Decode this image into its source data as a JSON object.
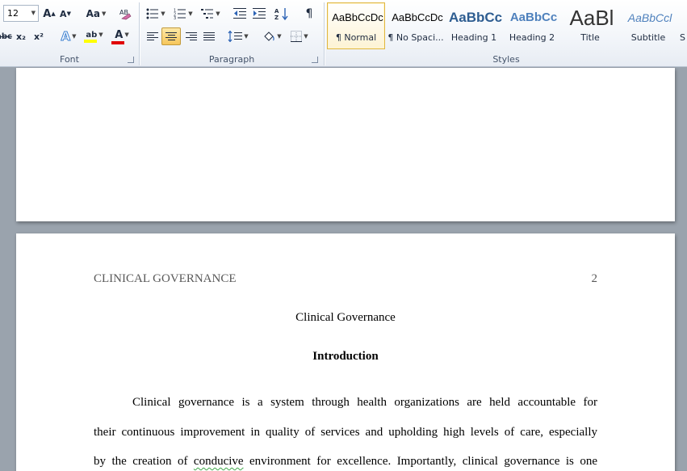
{
  "font_group": {
    "label": "Font",
    "font_size": "12",
    "grow_font": "A",
    "shrink_font": "A",
    "change_case": "Aa",
    "strikethrough": "abc",
    "subscript": "x₂",
    "superscript": "x²",
    "text_effects": "A",
    "highlight": "ab",
    "font_color": "A"
  },
  "paragraph_group": {
    "label": "Paragraph",
    "show_marks": "¶",
    "sort": "A↓Z"
  },
  "styles_group": {
    "label": "Styles",
    "tiles": [
      {
        "sample": "AaBbCcDc",
        "name": "¶ Normal"
      },
      {
        "sample": "AaBbCcDc",
        "name": "¶ No Spaci..."
      },
      {
        "sample": "AaBbCc",
        "name": "Heading 1"
      },
      {
        "sample": "AaBbCc",
        "name": "Heading 2"
      },
      {
        "sample": "AaBl",
        "name": "Title"
      },
      {
        "sample": "AaBbCcl",
        "name": "Subtitle"
      },
      {
        "sample": "",
        "name": "S"
      }
    ]
  },
  "colors": {
    "highlight_bar": "#ffff00",
    "font_color_bar": "#e00000",
    "heading1": "#2e5d91",
    "heading2": "#4f81bd",
    "subtitle": "#4f81bd"
  },
  "document": {
    "running_head": "CLINICAL GOVERNANCE",
    "page_number": "2",
    "title": "Clinical Governance",
    "heading": "Introduction",
    "paragraph_lines": [
      "Clinical governance is a system through health organizations are held accountable for",
      "their continuous improvement in quality of services and upholding high levels of care, especially",
      "by the creation of",
      "conducive",
      "environment for excellence. Importantly, clinical governance is one"
    ]
  }
}
